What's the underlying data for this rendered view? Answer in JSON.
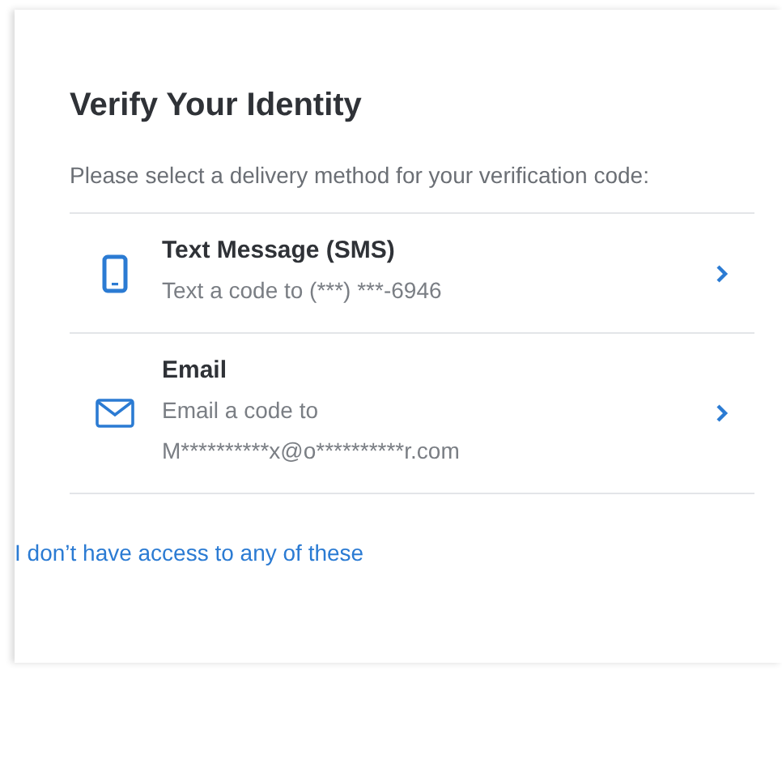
{
  "title": "Verify Your Identity",
  "instruction": "Please select a delivery method for your verification code:",
  "methods": [
    {
      "kind": "sms",
      "label": "Text Message (SMS)",
      "detail": "Text a code to (***) ***-6946"
    },
    {
      "kind": "email",
      "label": "Email",
      "detail": "Email a code to M**********x@o**********r.com"
    }
  ],
  "help_link": "I don’t have access to any of these"
}
